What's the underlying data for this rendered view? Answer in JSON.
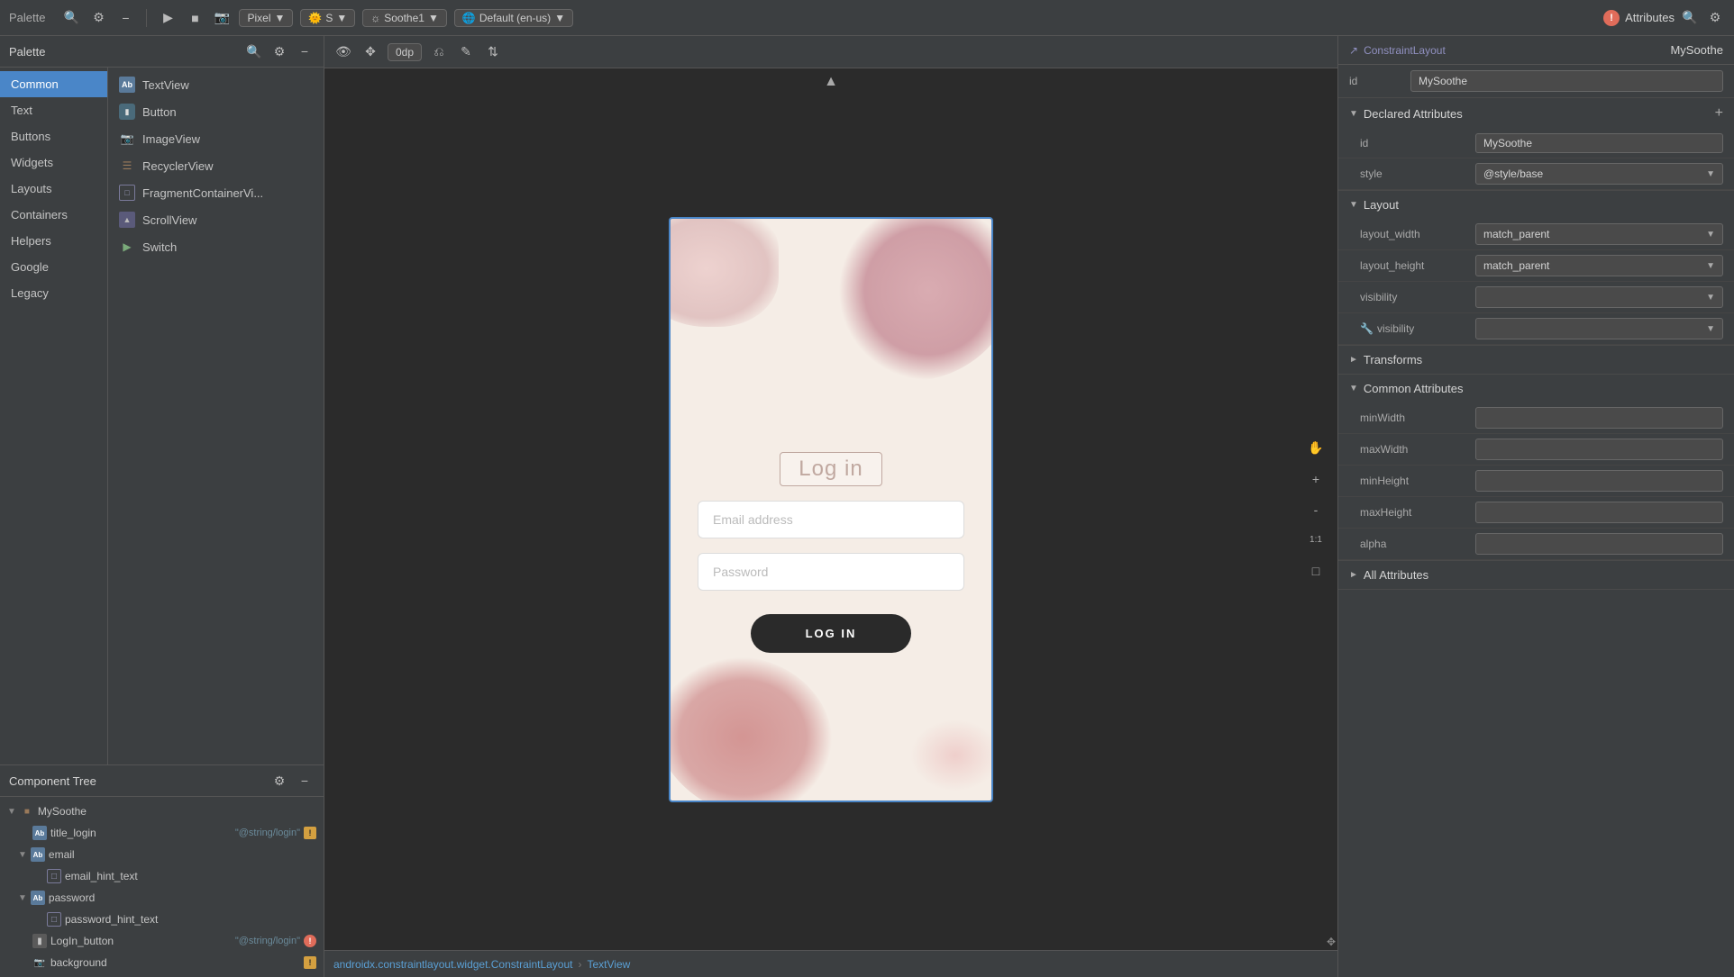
{
  "toolbar": {
    "title": "Palette",
    "pixel_label": "Pixel",
    "s_label": "S",
    "theme_label": "Soothe1",
    "locale_label": "Default (en-us)",
    "dp_value": "0dp",
    "attr_title": "Attributes",
    "constraint_layout": "ConstraintLayout",
    "my_soothe": "MySoothe"
  },
  "palette": {
    "nav_items": [
      {
        "id": "common",
        "label": "Common",
        "active": true
      },
      {
        "id": "text",
        "label": "Text"
      },
      {
        "id": "buttons",
        "label": "Buttons"
      },
      {
        "id": "widgets",
        "label": "Widgets"
      },
      {
        "id": "layouts",
        "label": "Layouts"
      },
      {
        "id": "containers",
        "label": "Containers"
      },
      {
        "id": "helpers",
        "label": "Helpers"
      },
      {
        "id": "google",
        "label": "Google"
      },
      {
        "id": "legacy",
        "label": "Legacy"
      }
    ],
    "items": [
      {
        "id": "textview",
        "label": "TextView",
        "icon": "ab"
      },
      {
        "id": "button",
        "label": "Button",
        "icon": "btn"
      },
      {
        "id": "imageview",
        "label": "ImageView",
        "icon": "img"
      },
      {
        "id": "recyclerview",
        "label": "RecyclerView",
        "icon": "list"
      },
      {
        "id": "fragmentcontainerview",
        "label": "FragmentContainerVi...",
        "icon": "frag"
      },
      {
        "id": "scrollview",
        "label": "ScrollView",
        "icon": "scroll"
      },
      {
        "id": "switch",
        "label": "Switch",
        "icon": "sw"
      }
    ]
  },
  "canvas": {
    "login_title": "Log in",
    "email_placeholder": "Email address",
    "password_placeholder": "Password",
    "login_btn_label": "LOG IN"
  },
  "component_tree": {
    "title": "Component Tree",
    "items": [
      {
        "id": "mysoothe",
        "label": "MySoothe",
        "icon": "plug",
        "indent": 0,
        "expand": true,
        "value": "",
        "warn": false,
        "error": false
      },
      {
        "id": "title_login",
        "label": "title_login",
        "icon": "ab",
        "indent": 1,
        "expand": false,
        "value": "\"@string/login\"",
        "warn": true,
        "error": false
      },
      {
        "id": "email",
        "label": "email",
        "icon": "ab",
        "indent": 1,
        "expand": true,
        "value": "",
        "warn": false,
        "error": false
      },
      {
        "id": "email_hint_text",
        "label": "email_hint_text",
        "icon": "box",
        "indent": 2,
        "expand": false,
        "value": "",
        "warn": false,
        "error": false
      },
      {
        "id": "password",
        "label": "password",
        "icon": "ab",
        "indent": 1,
        "expand": true,
        "value": "",
        "warn": false,
        "error": false
      },
      {
        "id": "password_hint_text",
        "label": "password_hint_text",
        "icon": "box",
        "indent": 2,
        "expand": false,
        "value": "",
        "warn": false,
        "error": false
      },
      {
        "id": "login_button",
        "label": "LogIn_button",
        "icon": "btn",
        "indent": 1,
        "expand": false,
        "value": "\"@string/login\"",
        "warn": false,
        "error": true
      },
      {
        "id": "background",
        "label": "background",
        "icon": "img",
        "indent": 1,
        "expand": false,
        "value": "",
        "warn": true,
        "error": false
      }
    ]
  },
  "attributes": {
    "title": "Attributes",
    "id_label": "id",
    "id_value": "MySoothe",
    "sections": {
      "declared": {
        "title": "Declared Attributes",
        "rows": [
          {
            "name": "id",
            "value": "MySoothe",
            "type": "text"
          },
          {
            "name": "style",
            "value": "@style/base",
            "type": "dropdown"
          }
        ]
      },
      "layout": {
        "title": "Layout",
        "rows": [
          {
            "name": "layout_width",
            "value": "match_parent",
            "type": "dropdown"
          },
          {
            "name": "layout_height",
            "value": "match_parent",
            "type": "dropdown"
          },
          {
            "name": "visibility",
            "value": "",
            "type": "dropdown"
          },
          {
            "name": "visibility",
            "value": "",
            "type": "dropdown",
            "has_icon": true,
            "icon": "wrench"
          }
        ]
      },
      "transforms": {
        "title": "Transforms",
        "rows": []
      },
      "common": {
        "title": "Common Attributes",
        "rows": [
          {
            "name": "minWidth",
            "value": "",
            "type": "empty"
          },
          {
            "name": "maxWidth",
            "value": "",
            "type": "empty"
          },
          {
            "name": "minHeight",
            "value": "",
            "type": "empty"
          },
          {
            "name": "maxHeight",
            "value": "",
            "type": "empty"
          },
          {
            "name": "alpha",
            "value": "",
            "type": "empty"
          }
        ]
      },
      "all": {
        "title": "All Attributes",
        "rows": []
      }
    }
  },
  "breadcrumb": {
    "parent": "androidx.constraintlayout.widget.ConstraintLayout",
    "child": "TextView"
  }
}
